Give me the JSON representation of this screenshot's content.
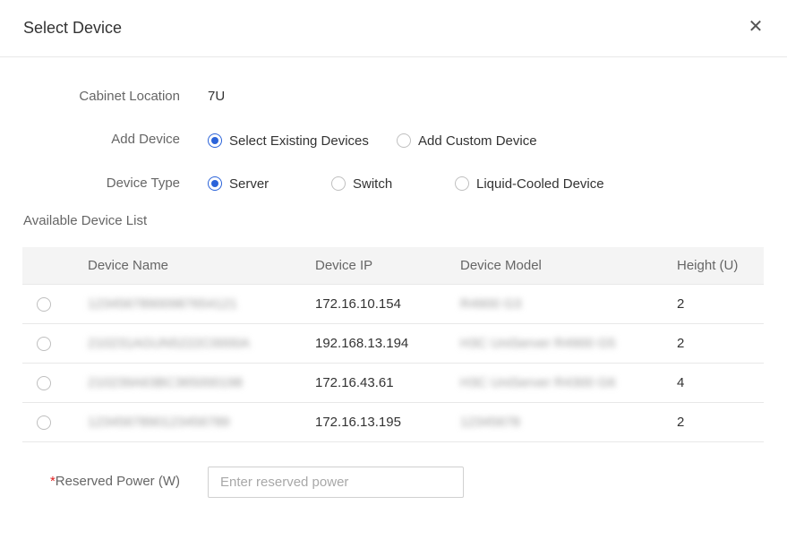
{
  "dialog": {
    "title": "Select Device",
    "close_glyph": "✕"
  },
  "form": {
    "cabinet_location": {
      "label": "Cabinet Location",
      "value": "7U"
    },
    "add_device": {
      "label": "Add Device",
      "options": [
        {
          "label": "Select Existing Devices",
          "selected": true
        },
        {
          "label": "Add Custom Device",
          "selected": false
        }
      ]
    },
    "device_type": {
      "label": "Device Type",
      "options": [
        {
          "label": "Server",
          "selected": true
        },
        {
          "label": "Switch",
          "selected": false
        },
        {
          "label": "Liquid-Cooled Device",
          "selected": false
        }
      ]
    },
    "reserved_power": {
      "required_mark": "*",
      "label": "Reserved Power (W)",
      "value": "",
      "placeholder": "Enter reserved power"
    }
  },
  "device_list": {
    "title": "Available Device List",
    "columns": [
      "Device Name",
      "Device IP",
      "Device Model",
      "Height (U)"
    ],
    "rows": [
      {
        "name": "12345678900987654121",
        "ip": "172.16.10.154",
        "model": "R4900 G3",
        "height": "2",
        "selected": false
      },
      {
        "name": "210231AGUN5222C0000A",
        "ip": "192.168.13.194",
        "model": "H3C UniServer R4900 G5",
        "height": "2",
        "selected": false
      },
      {
        "name": "210239A63BC365000198",
        "ip": "172.16.43.61",
        "model": "H3C UniServer R4300 G6",
        "height": "4",
        "selected": false
      },
      {
        "name": "1234567890123456789",
        "ip": "172.16.13.195",
        "model": "12345678",
        "height": "2",
        "selected": false
      }
    ]
  },
  "colors": {
    "accent": "#2b63d9",
    "required": "#e02020",
    "header_bg": "#f4f4f4"
  }
}
